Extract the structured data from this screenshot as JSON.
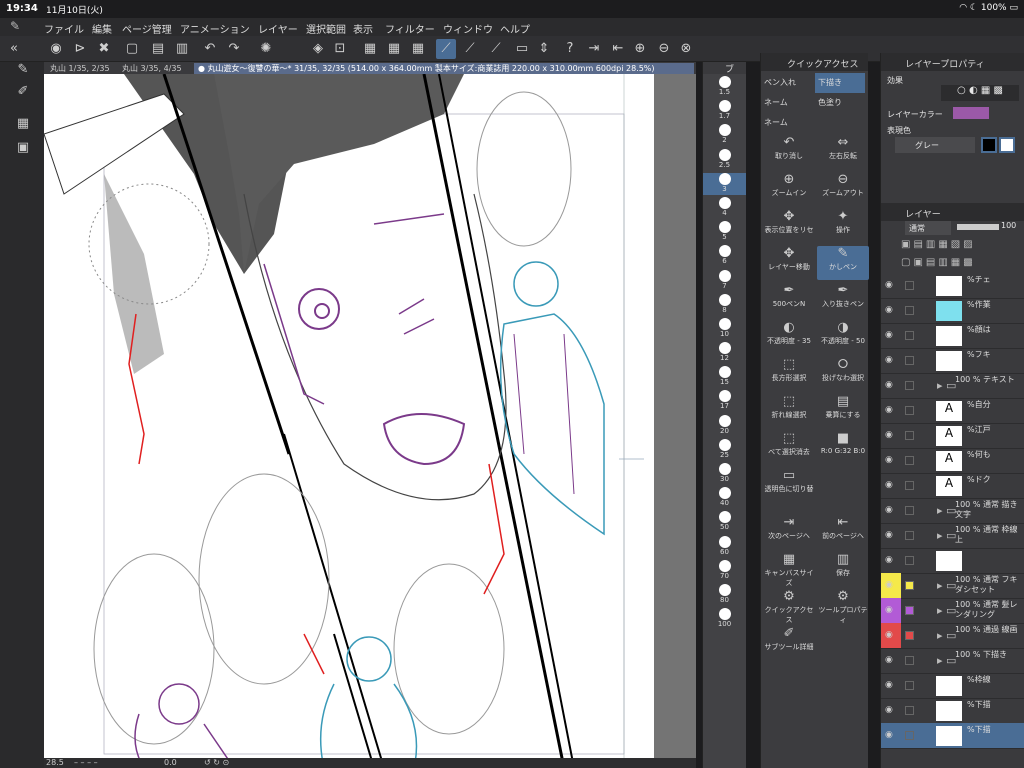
{
  "status": {
    "time": "19:34",
    "date": "11月10日(火)",
    "battery": "100%",
    "wifi_icon": "wifi-icon",
    "moon_icon": "moon-icon"
  },
  "menu": {
    "items": [
      "ファイル",
      "編集",
      "ページ管理",
      "アニメーション",
      "レイヤー",
      "選択範囲",
      "表示",
      "フィルター",
      "ウィンドウ",
      "ヘルプ"
    ]
  },
  "tabs": [
    {
      "label": "丸山 1/35, 2/35"
    },
    {
      "label": "丸山 3/35, 4/35"
    },
    {
      "label": "● 丸山遊女〜復讐の華〜* 31/35, 32/35 (514.00 x 364.00mm 製本サイズ:商業誌用 220.00 x 310.00mm 600dpi 28.5%)"
    }
  ],
  "bottom": {
    "zoom": "28.5",
    "rotate": "0.0"
  },
  "brush_panel": {
    "sizes": [
      "1.5",
      "1.7",
      "2",
      "2.5",
      "3",
      "4",
      "5",
      "6",
      "7",
      "8",
      "10",
      "12",
      "15",
      "17",
      "20",
      "25",
      "30",
      "40",
      "50",
      "60",
      "70",
      "80",
      "100"
    ],
    "selected": "3"
  },
  "quick": {
    "title": "クイックアクセス",
    "cells": [
      [
        "ペン入れ",
        "下描き"
      ],
      [
        "ネーム",
        "色塗り"
      ],
      [
        "ネーム",
        ""
      ]
    ],
    "items": [
      [
        "取り消し",
        "左右反転"
      ],
      [
        "ズームイン",
        "ズームアウト"
      ],
      [
        "表示位置をリセ",
        "操作"
      ],
      [
        "レイヤー移動",
        "かしペン"
      ],
      [
        "500ペンN",
        "入り抜きペン"
      ],
      [
        "不透明度 - 35",
        "不透明度 - 50"
      ],
      [
        "長方形選択",
        "投げなわ選択"
      ],
      [
        "折れ線選択",
        "乗算にする"
      ],
      [
        "べて選択消去",
        "R:0 G:32 B:0"
      ],
      [
        "透明色に切り替",
        ""
      ],
      [
        "次のページへ",
        "前のページへ"
      ],
      [
        "キャンバスサイズ",
        "保存"
      ],
      [
        "クイックアクセス",
        "ツールプロパティ"
      ],
      [
        "サブツール詳細",
        ""
      ]
    ]
  },
  "props": {
    "title": "レイヤープロパティ",
    "effect": "効果",
    "layer_color": "レイヤーカラー",
    "expression": "表現色",
    "gray": "グレー"
  },
  "layers": {
    "title": "レイヤー",
    "blend": "通常",
    "opacity": "100",
    "rows": [
      {
        "name": "%チェ",
        "type": "img",
        "thumb": "#ffffff",
        "bg": ""
      },
      {
        "name": "%作業",
        "type": "img",
        "thumb": "#7ee0ee",
        "bg": ""
      },
      {
        "name": "%顔は",
        "type": "img",
        "thumb": "#ffffff",
        "bg": ""
      },
      {
        "name": "%フキ",
        "type": "img",
        "thumb": "#ffffff",
        "bg": ""
      },
      {
        "name": "100 % テキスト",
        "type": "folder",
        "thumb": "",
        "bg": ""
      },
      {
        "name": "%自分",
        "type": "text",
        "thumb": "#ffffff",
        "bg": ""
      },
      {
        "name": "%江戸",
        "type": "text",
        "thumb": "#ffffff",
        "bg": ""
      },
      {
        "name": "%何も",
        "type": "text",
        "thumb": "#ffffff",
        "bg": ""
      },
      {
        "name": "%ドク",
        "type": "text",
        "thumb": "#ffffff",
        "bg": ""
      },
      {
        "name": "100 % 通常 描き文字",
        "type": "folder",
        "thumb": "",
        "bg": ""
      },
      {
        "name": "100 % 通常 枠線上",
        "type": "folder",
        "thumb": "",
        "bg": ""
      },
      {
        "name": "",
        "type": "img",
        "thumb": "#ffffff",
        "bg": ""
      },
      {
        "name": "100 % 通常 フキダシセット",
        "type": "folder",
        "thumb": "",
        "bg": "#f5e94a"
      },
      {
        "name": "100 % 通常 髪レンダリング",
        "type": "folder",
        "thumb": "",
        "bg": "#b25bd6"
      },
      {
        "name": "100 % 通過 線画",
        "type": "folder",
        "thumb": "",
        "bg": "#e24a4a"
      },
      {
        "name": "100 % 下描き",
        "type": "folder",
        "thumb": "",
        "bg": ""
      },
      {
        "name": "%枠線",
        "type": "img",
        "thumb": "#ffffff",
        "bg": ""
      },
      {
        "name": "%下描",
        "type": "img",
        "thumb": "#ffffff",
        "bg": ""
      },
      {
        "name": "%下描",
        "type": "img",
        "thumb": "#ffffff",
        "bg": ""
      }
    ]
  }
}
